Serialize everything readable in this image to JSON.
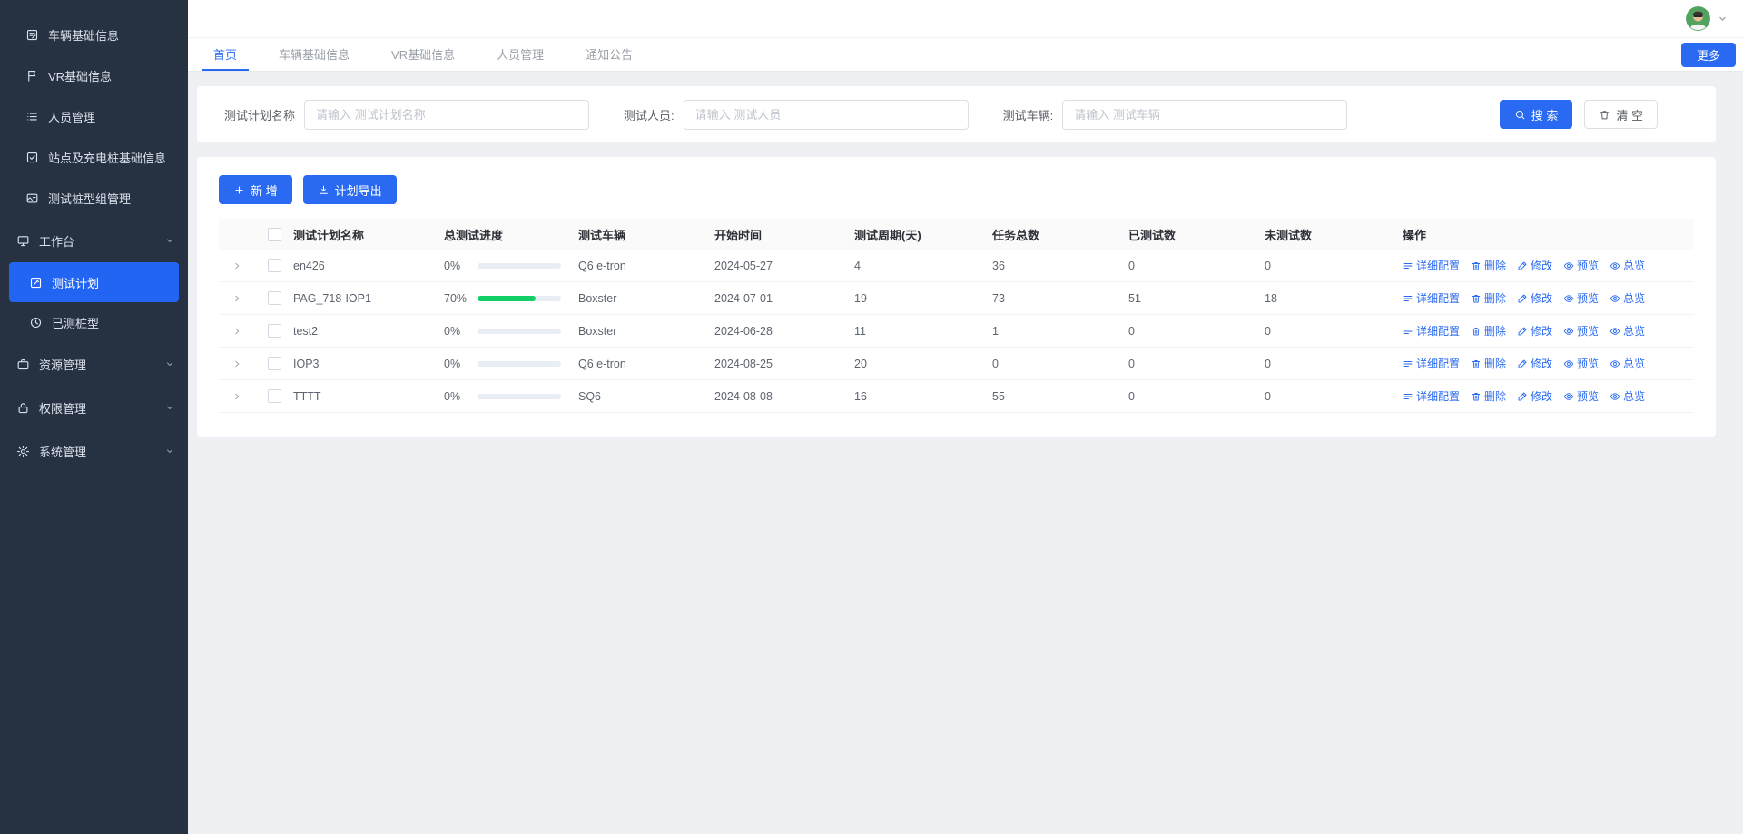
{
  "sidebar": {
    "items": [
      {
        "label": "车辆基础信息",
        "icon": "doc-edit-icon",
        "level": "item"
      },
      {
        "label": "VR基础信息",
        "icon": "flag-icon",
        "level": "item"
      },
      {
        "label": "人员管理",
        "icon": "list-icon",
        "level": "item"
      },
      {
        "label": "站点及充电桩基础信息",
        "icon": "check-square-icon",
        "level": "item"
      },
      {
        "label": "测试桩型组管理",
        "icon": "card-icon",
        "level": "item"
      },
      {
        "label": "工作台",
        "icon": "monitor-icon",
        "level": "group",
        "chevron": "chevron-down-icon"
      },
      {
        "label": "测试计划",
        "icon": "edit-square-icon",
        "level": "sub",
        "active": true
      },
      {
        "label": "已测桩型",
        "icon": "history-icon",
        "level": "sub"
      },
      {
        "label": "资源管理",
        "icon": "briefcase-icon",
        "level": "group",
        "chevron": "chevron-down-icon"
      },
      {
        "label": "权限管理",
        "icon": "lock-icon",
        "level": "group",
        "chevron": "chevron-down-icon"
      },
      {
        "label": "系统管理",
        "icon": "gear-icon",
        "level": "group",
        "chevron": "chevron-down-icon"
      }
    ]
  },
  "topbar": {
    "more_label": "更多"
  },
  "tabs": [
    {
      "label": "首页",
      "active": true
    },
    {
      "label": "车辆基础信息",
      "active": false
    },
    {
      "label": "VR基础信息",
      "active": false
    },
    {
      "label": "人员管理",
      "active": false
    },
    {
      "label": "通知公告",
      "active": false
    }
  ],
  "filter_bar": {
    "fields": [
      {
        "label": "测试计划名称",
        "placeholder": "请输入 测试计划名称"
      },
      {
        "label": "测试人员:",
        "placeholder": "请输入 测试人员"
      },
      {
        "label": "测试车辆:",
        "placeholder": "请输入 测试车辆"
      }
    ],
    "search_label": "搜 索",
    "clear_label": "清 空"
  },
  "toolbar": {
    "add_label": "新 增",
    "export_label": "计划导出"
  },
  "table": {
    "columns": [
      "测试计划名称",
      "总测试进度",
      "测试车辆",
      "开始时间",
      "测试周期(天)",
      "任务总数",
      "已测试数",
      "未测试数",
      "操作"
    ],
    "action_labels": [
      "详细配置",
      "删除",
      "修改",
      "预览",
      "总览"
    ],
    "action_icons": [
      "detail-icon",
      "trash-icon",
      "edit-icon",
      "eye-icon",
      "eye-icon"
    ],
    "rows": [
      {
        "name": "en426",
        "progress_label": "0%",
        "progress_value": 0,
        "vehicle": "Q6 e-tron",
        "start_date": "2024-05-27",
        "cycle_days": "4",
        "task_total": "36",
        "tested": "0",
        "untested": "0"
      },
      {
        "name": "PAG_718-IOP1",
        "progress_label": "70%",
        "progress_value": 70,
        "vehicle": "Boxster",
        "start_date": "2024-07-01",
        "cycle_days": "19",
        "task_total": "73",
        "tested": "51",
        "untested": "18"
      },
      {
        "name": "test2",
        "progress_label": "0%",
        "progress_value": 0,
        "vehicle": "Boxster",
        "start_date": "2024-06-28",
        "cycle_days": "11",
        "task_total": "1",
        "tested": "0",
        "untested": "0"
      },
      {
        "name": "IOP3",
        "progress_label": "0%",
        "progress_value": 0,
        "vehicle": "Q6 e-tron",
        "start_date": "2024-08-25",
        "cycle_days": "20",
        "task_total": "0",
        "tested": "0",
        "untested": "0"
      },
      {
        "name": "TTTT",
        "progress_label": "0%",
        "progress_value": 0,
        "vehicle": "SQ6",
        "start_date": "2024-08-08",
        "cycle_days": "16",
        "task_total": "55",
        "tested": "0",
        "untested": "0"
      }
    ]
  },
  "colors": {
    "primary": "#2a6af2",
    "sidebar_bg": "#263142",
    "sidebar_active": "#2165f2",
    "success": "#13ce66",
    "content_bg": "#eef0f4"
  }
}
